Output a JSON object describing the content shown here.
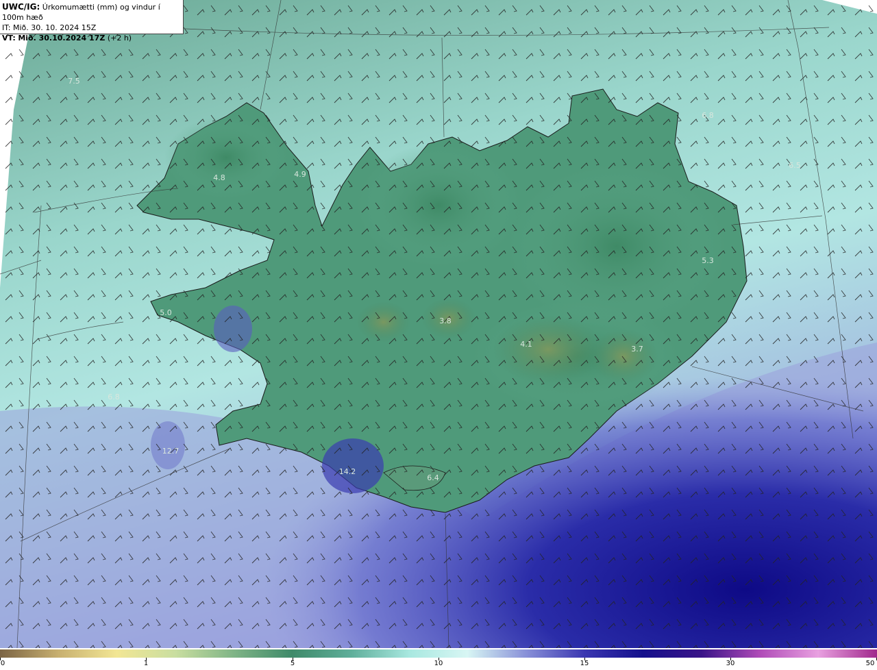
{
  "header": {
    "product": "UWC/IG:",
    "title": "Úrkomumætti (mm) og vindur í 100m hæð",
    "it_label": "IT:",
    "it_value": "Mið. 30. 10. 2024 15Z",
    "vt_label": "VT:",
    "vt_value": "Mið. 30.10.2024 17Z",
    "vt_offset": "(+2 h)"
  },
  "map_labels": [
    "7.5",
    "4.8",
    "4.9",
    "6.8",
    "6.5",
    "5.3",
    "3.8",
    "4.1",
    "3.7",
    "5.0",
    "6.8",
    "12.7",
    "14.2",
    "6.4"
  ],
  "colorbar": {
    "ticks": [
      "0",
      "1",
      "5",
      "10",
      "15",
      "30",
      "50"
    ],
    "colors": [
      "#7b6445",
      "#c8b070",
      "#f2e694",
      "#c9dea0",
      "#7fb486",
      "#3f8a6a",
      "#5fae9a",
      "#a8e8e0",
      "#d8f6f4",
      "#8890d8",
      "#3a36b0",
      "#14108c",
      "#3a1488",
      "#b04cb8",
      "#e8a0e0",
      "#a0288c"
    ]
  }
}
